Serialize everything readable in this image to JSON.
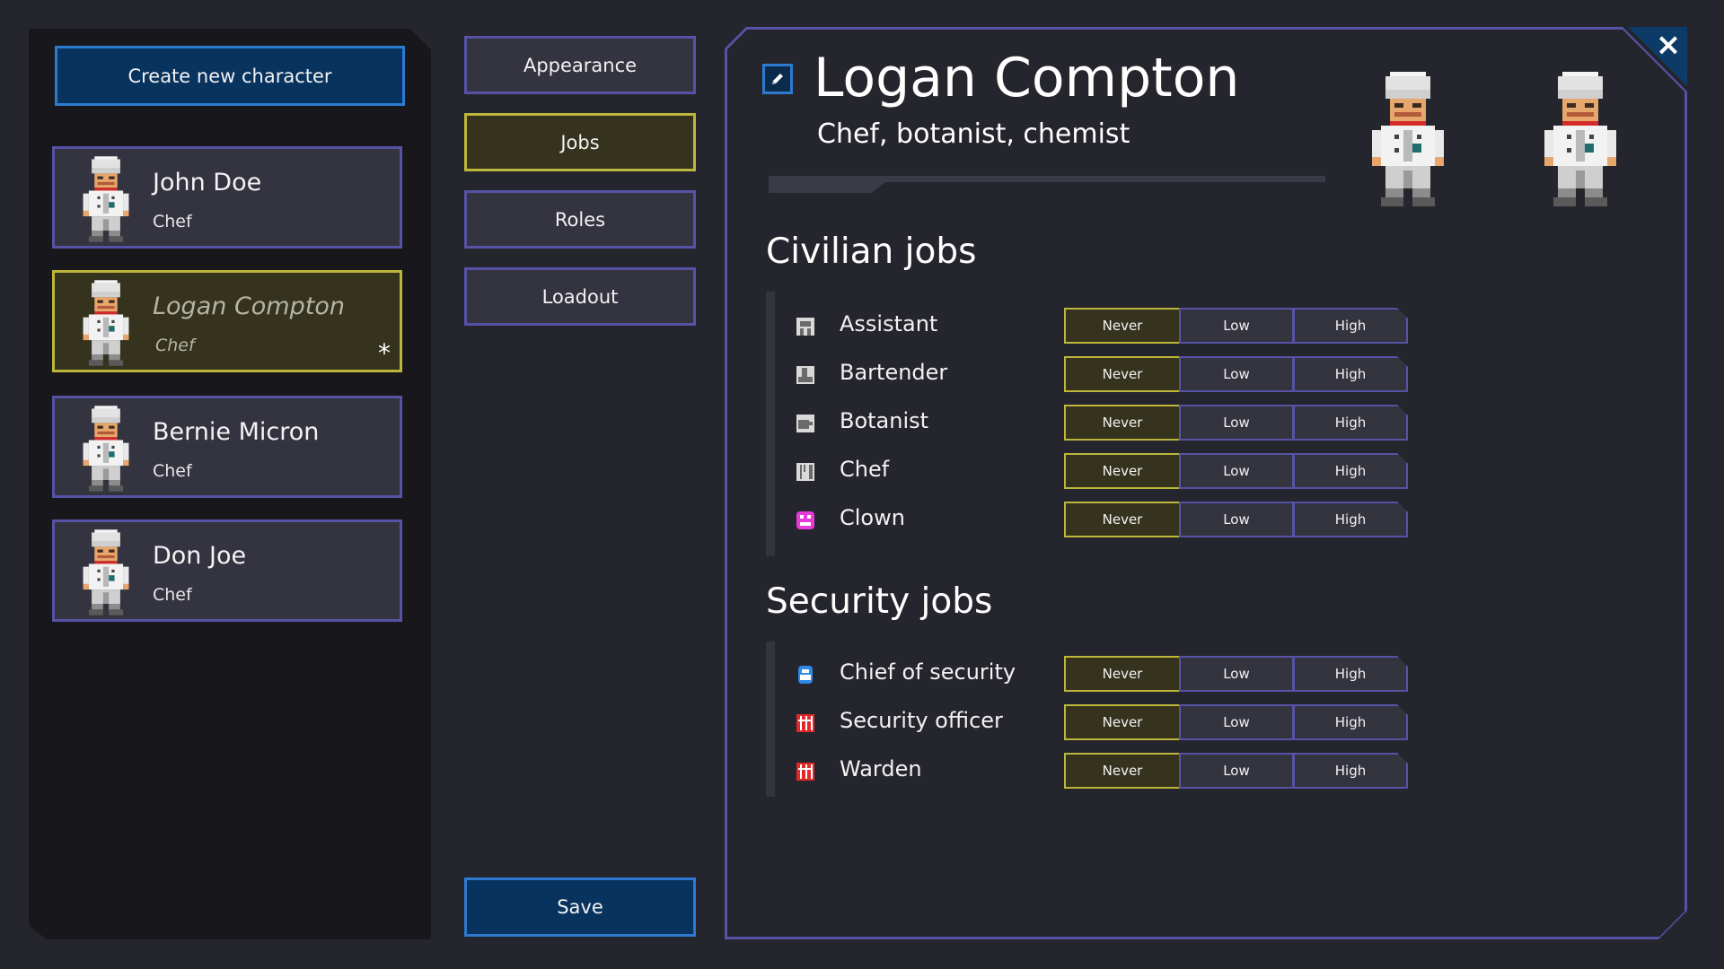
{
  "sidebar": {
    "create_label": "Create new character",
    "characters": [
      {
        "name": "John Doe",
        "job": "Chef",
        "selected": false
      },
      {
        "name": "Logan Compton",
        "job": "Chef",
        "selected": true,
        "unsaved_marker": "*"
      },
      {
        "name": "Bernie Micron",
        "job": "Chef",
        "selected": false
      },
      {
        "name": "Don Joe",
        "job": "Chef",
        "selected": false
      }
    ]
  },
  "tabs": [
    {
      "label": "Appearance",
      "active": false
    },
    {
      "label": "Jobs",
      "active": true
    },
    {
      "label": "Roles",
      "active": false
    },
    {
      "label": "Loadout",
      "active": false
    }
  ],
  "save_label": "Save",
  "profile": {
    "name": "Logan Compton",
    "subtitle": "Chef, botanist, chemist",
    "close_glyph": "×"
  },
  "priority_labels": {
    "never": "Never",
    "low": "Low",
    "high": "High"
  },
  "sections": [
    {
      "title": "Civilian jobs",
      "jobs": [
        {
          "name": "Assistant",
          "icon": "assistant-icon",
          "priority": "Never"
        },
        {
          "name": "Bartender",
          "icon": "bartender-icon",
          "priority": "Never"
        },
        {
          "name": "Botanist",
          "icon": "botanist-icon",
          "priority": "Never"
        },
        {
          "name": "Chef",
          "icon": "chef-icon",
          "priority": "Never"
        },
        {
          "name": "Clown",
          "icon": "clown-icon",
          "priority": "Never"
        }
      ]
    },
    {
      "title": "Security jobs",
      "jobs": [
        {
          "name": "Chief of security",
          "icon": "chief-of-security-icon",
          "priority": "Never"
        },
        {
          "name": "Security officer",
          "icon": "security-officer-icon",
          "priority": "Never"
        },
        {
          "name": "Warden",
          "icon": "warden-icon",
          "priority": "Never"
        }
      ]
    }
  ],
  "colors": {
    "background": "#25252d",
    "panel": "#18181c",
    "card": "#343340",
    "card_border": "#5653a6",
    "selected": "#35331e",
    "selected_border": "#bcb63b",
    "accent_blue": "#08335e",
    "accent_blue_border": "#2d7ad0"
  }
}
